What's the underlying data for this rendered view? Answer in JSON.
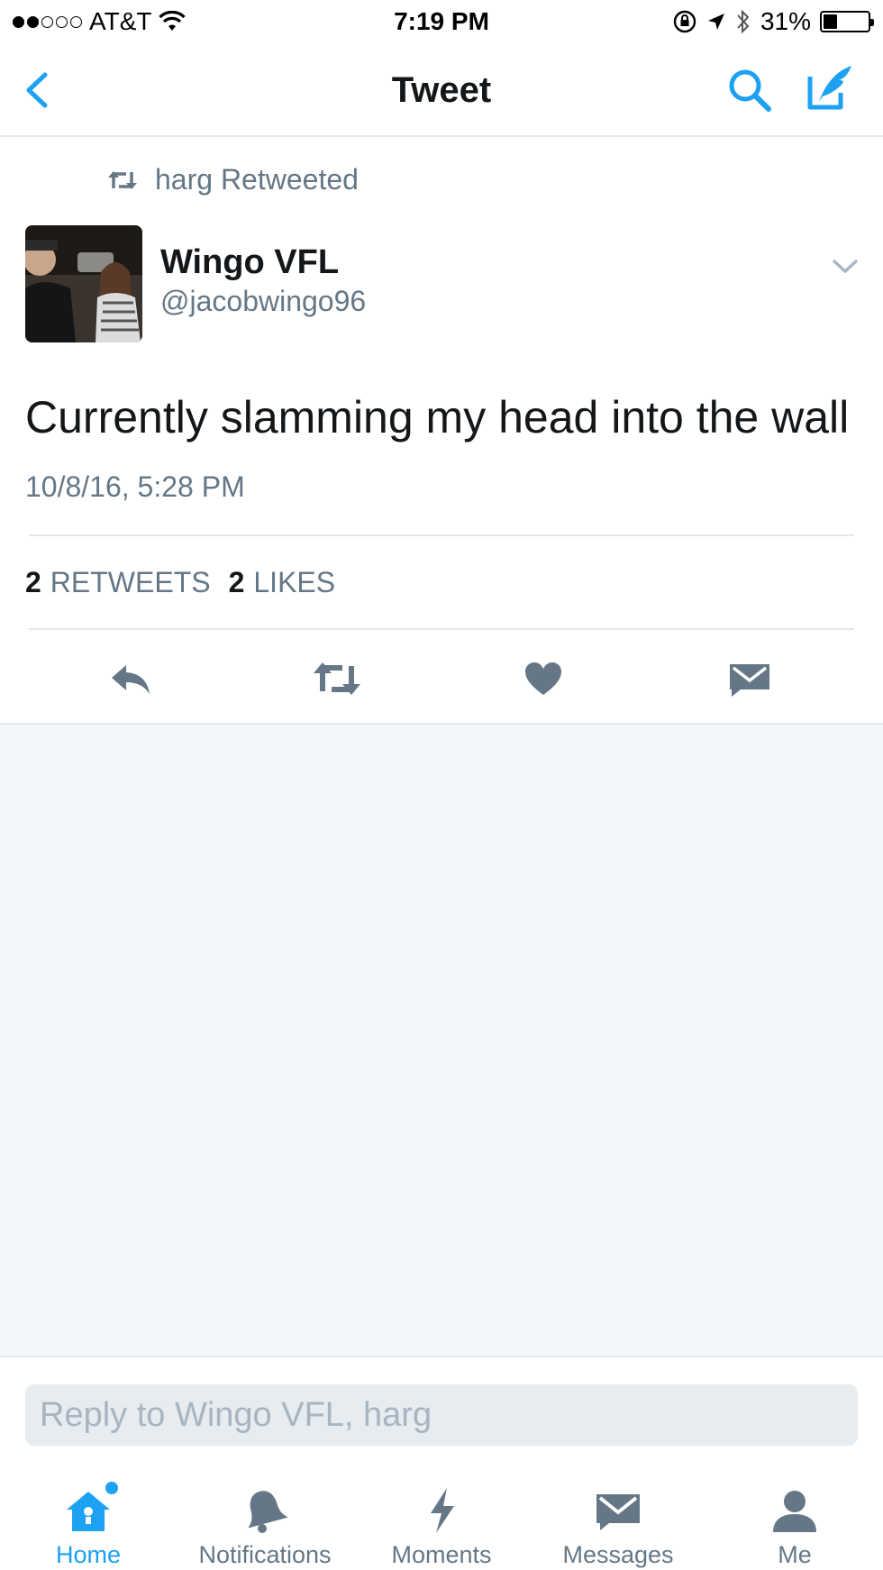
{
  "status_bar": {
    "carrier": "AT&T",
    "time": "7:19 PM",
    "battery": "31%",
    "battery_level": 0.31,
    "signal_bars_filled": 2,
    "signal_bars_total": 5
  },
  "nav": {
    "title": "Tweet",
    "icons": [
      "back-chevron-icon",
      "search-icon",
      "compose-icon"
    ],
    "accent_color": "#1da1f2"
  },
  "tweet": {
    "retweeted_by": "harg Retweeted",
    "author_name": "Wingo VFL",
    "author_handle": "@jacobwingo96",
    "text": "Currently slamming my head into the wall",
    "timestamp": "10/8/16, 5:28 PM",
    "retweet_count": "2",
    "retweet_label": "RETWEETS",
    "like_count": "2",
    "like_label": "LIKES"
  },
  "actions": [
    "reply-icon",
    "retweet-icon",
    "like-icon",
    "direct-message-icon"
  ],
  "reply": {
    "placeholder": "Reply to Wingo VFL, harg",
    "value": ""
  },
  "tabs": [
    {
      "label": "Home",
      "icon": "home-icon",
      "active": true
    },
    {
      "label": "Notifications",
      "icon": "bell-icon",
      "active": false
    },
    {
      "label": "Moments",
      "icon": "lightning-icon",
      "active": false
    },
    {
      "label": "Messages",
      "icon": "envelope-icon",
      "active": false
    },
    {
      "label": "Me",
      "icon": "person-icon",
      "active": false
    }
  ],
  "colors": {
    "accent": "#1da1f2",
    "secondary_text": "#657786",
    "primary_text": "#14171a",
    "background_gray": "#f3f6f9"
  }
}
